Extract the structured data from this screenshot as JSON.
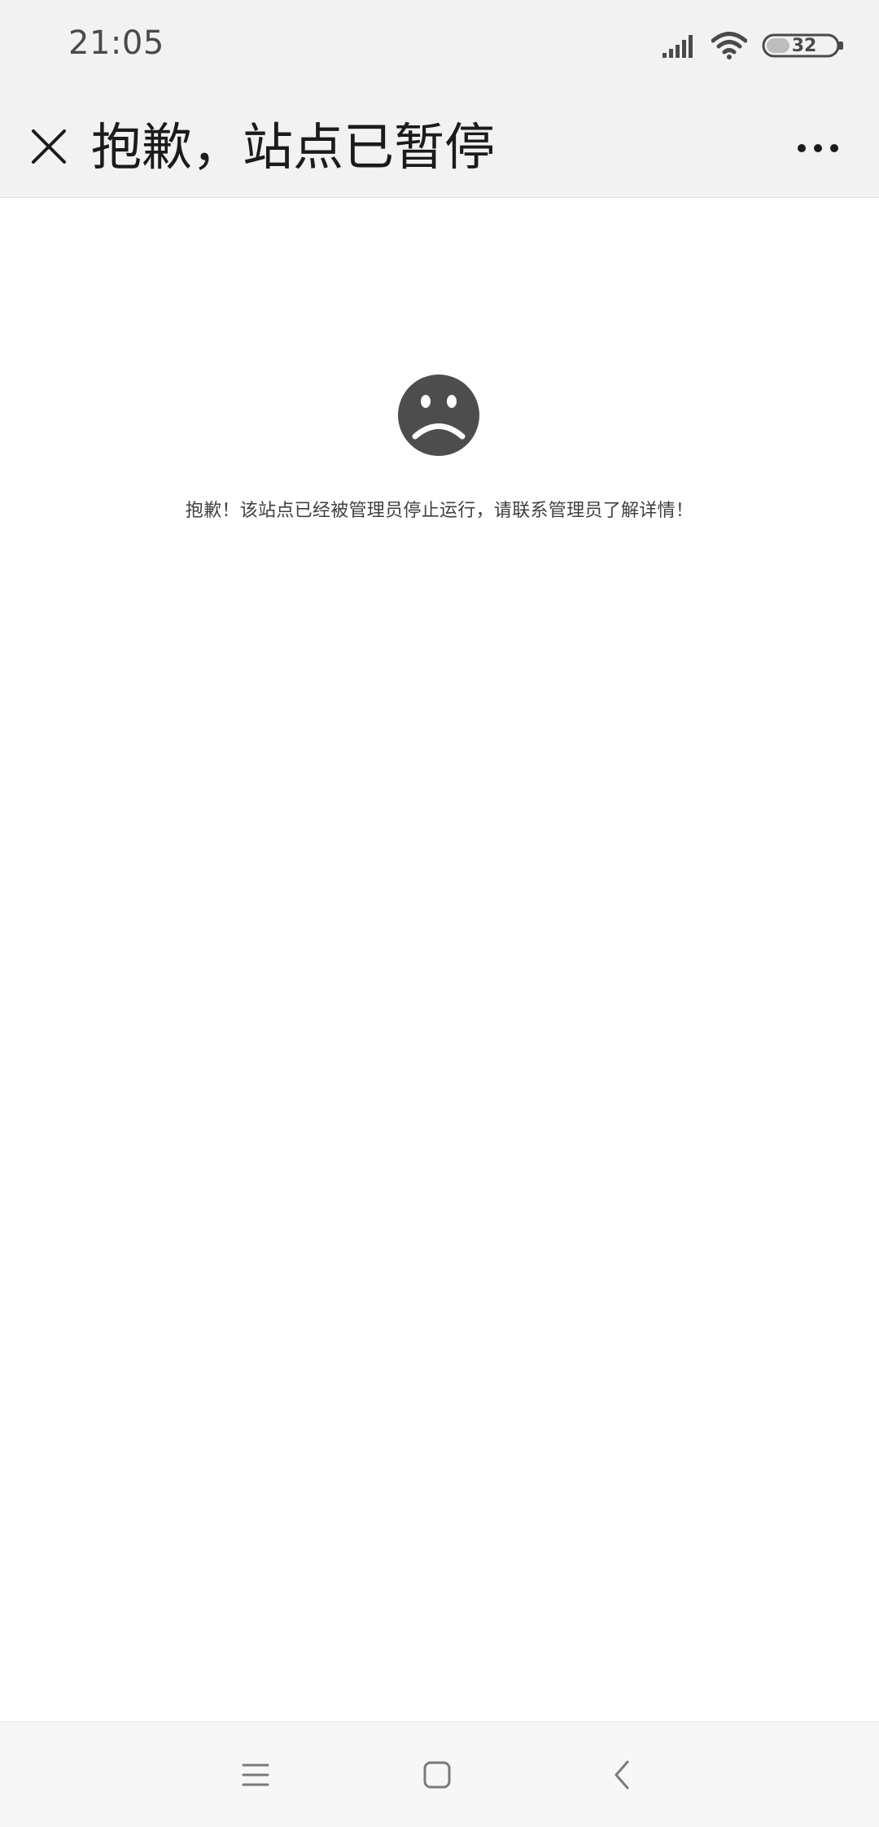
{
  "status_bar": {
    "time": "21:05",
    "battery_level": "32",
    "icons": [
      "signal-icon",
      "wifi-icon",
      "battery-icon"
    ]
  },
  "title_bar": {
    "title": "抱歉，站点已暂停",
    "close_icon": "close-icon",
    "more_icon": "more-icon"
  },
  "content": {
    "icon": "sad-face-icon",
    "message": "抱歉！该站点已经被管理员停止运行，请联系管理员了解详情！",
    "icon_color": "#4d4d4d"
  },
  "nav_bar": {
    "icons": [
      "menu-icon",
      "home-icon",
      "back-icon"
    ]
  }
}
